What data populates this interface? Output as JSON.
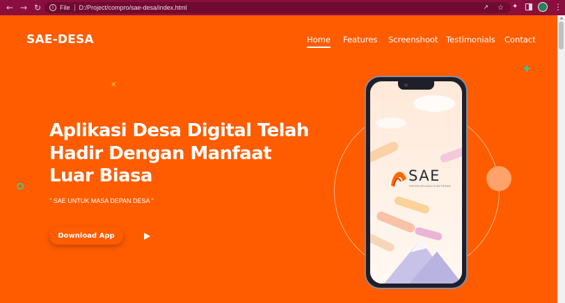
{
  "browser": {
    "scheme_label": "File",
    "url": "D:/Project/compro/sae-desa/index.html"
  },
  "nav": {
    "brand": "SAE-DESA",
    "items": [
      {
        "label": "Home",
        "active": true
      },
      {
        "label": "Features",
        "active": false
      },
      {
        "label": "Screenshoot",
        "active": false
      },
      {
        "label": "Testimonials",
        "active": false
      },
      {
        "label": "Contact",
        "active": false
      }
    ]
  },
  "hero": {
    "headline_lines": [
      "Aplikasi Desa Digital Telah",
      "Hadir Dengan Manfaat",
      "Luar Biasa"
    ],
    "tagline": "\" SAE UNTUK MASA DEPAN DESA \"",
    "cta_label": "Download App"
  },
  "phone_app": {
    "logo_word": "SAE",
    "logo_subtitle": "SISTEM APLIKASI ELEKTRONIK"
  },
  "colors": {
    "chrome": "#8a0f3e",
    "page_bg": "#ff5c00",
    "accent_yellow": "#ffd21f",
    "accent_green": "#56c27a"
  },
  "icons": [
    "back-arrow-icon",
    "forward-arrow-icon",
    "reload-icon",
    "info-icon",
    "share-icon",
    "star-icon",
    "extensions-icon",
    "side-panel-icon",
    "profile-avatar",
    "more-menu-icon",
    "play-icon"
  ]
}
